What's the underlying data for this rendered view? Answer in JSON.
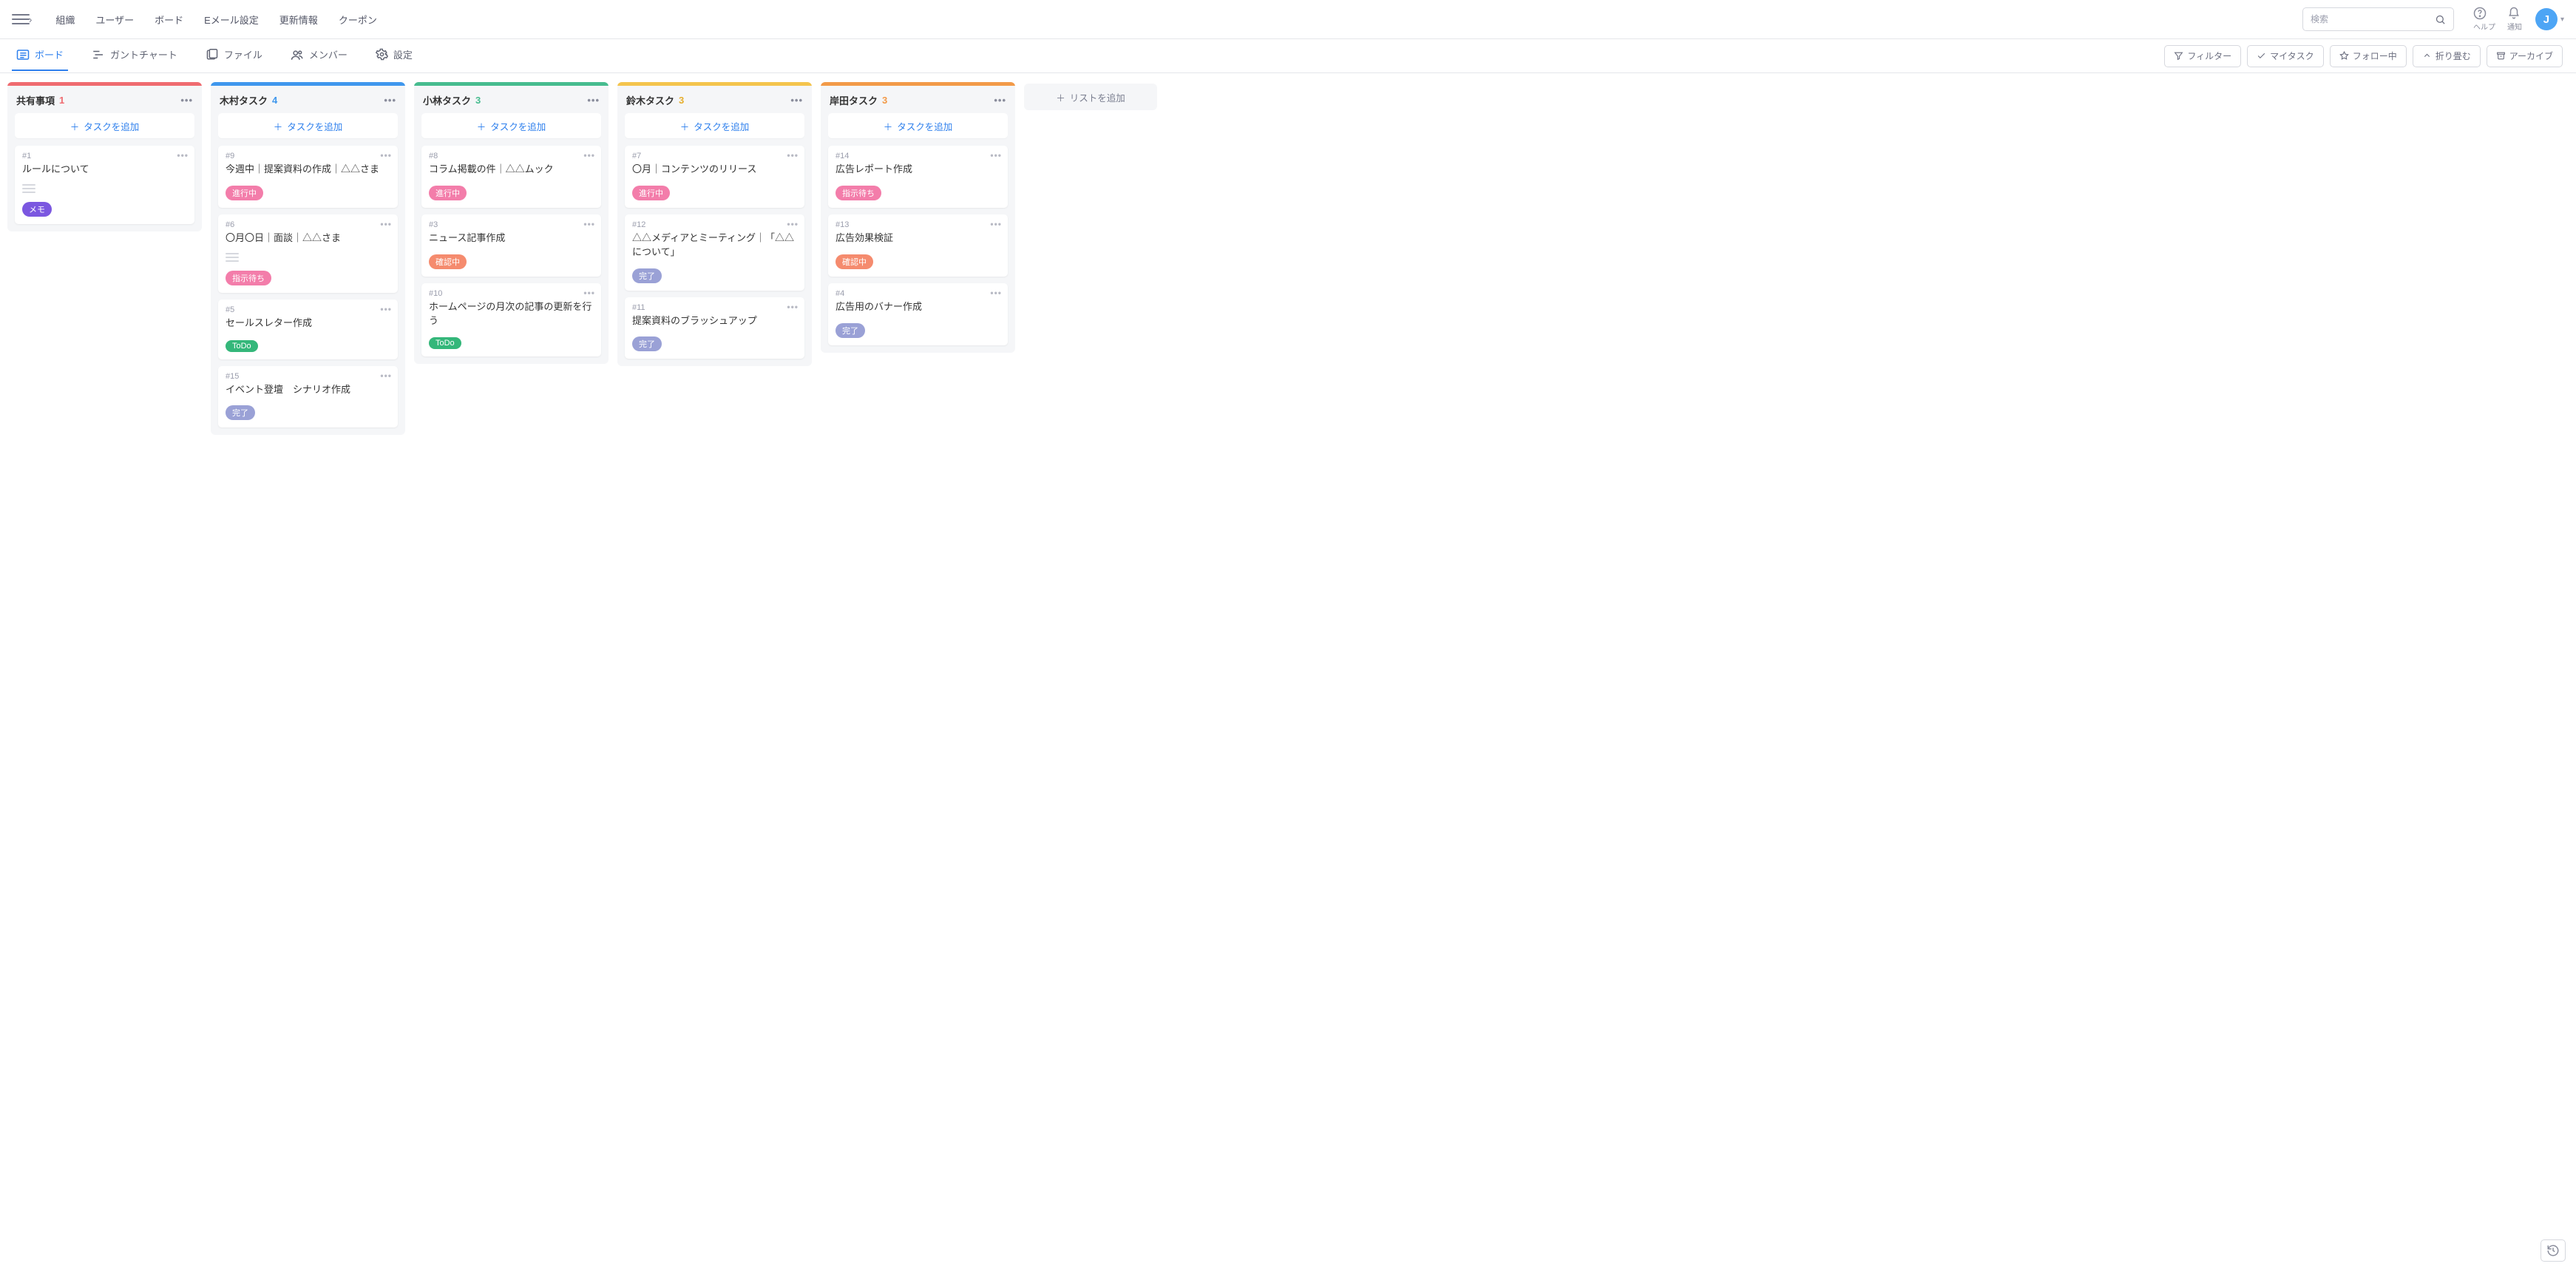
{
  "topnav": {
    "items": [
      "組織",
      "ユーザー",
      "ボード",
      "Eメール設定",
      "更新情報",
      "クーポン"
    ]
  },
  "search": {
    "placeholder": "検索"
  },
  "headerIcons": {
    "help": "ヘルプ",
    "notify": "通知"
  },
  "avatarInitial": "J",
  "viewTabs": {
    "board": "ボード",
    "gantt": "ガントチャート",
    "files": "ファイル",
    "members": "メンバー",
    "settings": "設定"
  },
  "pillButtons": {
    "filter": "フィルター",
    "mytask": "マイタスク",
    "follow": "フォロー中",
    "collapse": "折り畳む",
    "archive": "アーカイブ"
  },
  "addTaskLabel": "タスクを追加",
  "addListLabel": "リストを追加",
  "lists": [
    {
      "title": "共有事項",
      "count": "1",
      "capClass": "cap-red",
      "countClass": "cnt-red",
      "cards": [
        {
          "num": "#1",
          "title": "ルールについて",
          "memoLines": true,
          "tag": {
            "text": "メモ",
            "cls": "tag-purple"
          }
        }
      ]
    },
    {
      "title": "木村タスク",
      "count": "4",
      "capClass": "cap-blue",
      "countClass": "cnt-blue",
      "cards": [
        {
          "num": "#9",
          "title": "今週中｜提案資料の作成｜△△さま",
          "tag": {
            "text": "進行中",
            "cls": "tag-pink"
          }
        },
        {
          "num": "#6",
          "title": "〇月〇日｜面談｜△△さま",
          "memoLines": true,
          "tag": {
            "text": "指示待ち",
            "cls": "tag-pink"
          }
        },
        {
          "num": "#5",
          "title": "セールスレター作成",
          "tag": {
            "text": "ToDo",
            "cls": "tag-green"
          }
        },
        {
          "num": "#15",
          "title": "イベント登壇　シナリオ作成",
          "tag": {
            "text": "完了",
            "cls": "tag-lav"
          }
        }
      ]
    },
    {
      "title": "小林タスク",
      "count": "3",
      "capClass": "cap-green",
      "countClass": "cnt-green",
      "cards": [
        {
          "num": "#8",
          "title": "コラム掲載の件｜△△ムック",
          "tag": {
            "text": "進行中",
            "cls": "tag-pink"
          }
        },
        {
          "num": "#3",
          "title": "ニュース記事作成",
          "tag": {
            "text": "確認中",
            "cls": "tag-salmon"
          }
        },
        {
          "num": "#10",
          "title": "ホームページの月次の記事の更新を行う",
          "tag": {
            "text": "ToDo",
            "cls": "tag-green"
          }
        }
      ]
    },
    {
      "title": "鈴木タスク",
      "count": "3",
      "capClass": "cap-yellow",
      "countClass": "cnt-yellow",
      "cards": [
        {
          "num": "#7",
          "title": "〇月｜コンテンツのリリース",
          "tag": {
            "text": "進行中",
            "cls": "tag-pink"
          }
        },
        {
          "num": "#12",
          "title": "△△メディアとミーティング｜「△△について」",
          "tag": {
            "text": "完了",
            "cls": "tag-lav"
          }
        },
        {
          "num": "#11",
          "title": "提案資料のブラッシュアップ",
          "tag": {
            "text": "完了",
            "cls": "tag-lav"
          }
        }
      ]
    },
    {
      "title": "岸田タスク",
      "count": "3",
      "capClass": "cap-orange",
      "countClass": "cnt-orange",
      "cards": [
        {
          "num": "#14",
          "title": "広告レポート作成",
          "tag": {
            "text": "指示待ち",
            "cls": "tag-pink"
          }
        },
        {
          "num": "#13",
          "title": "広告効果検証",
          "tag": {
            "text": "確認中",
            "cls": "tag-salmon"
          }
        },
        {
          "num": "#4",
          "title": "広告用のバナー作成",
          "tag": {
            "text": "完了",
            "cls": "tag-lav"
          }
        }
      ]
    }
  ]
}
